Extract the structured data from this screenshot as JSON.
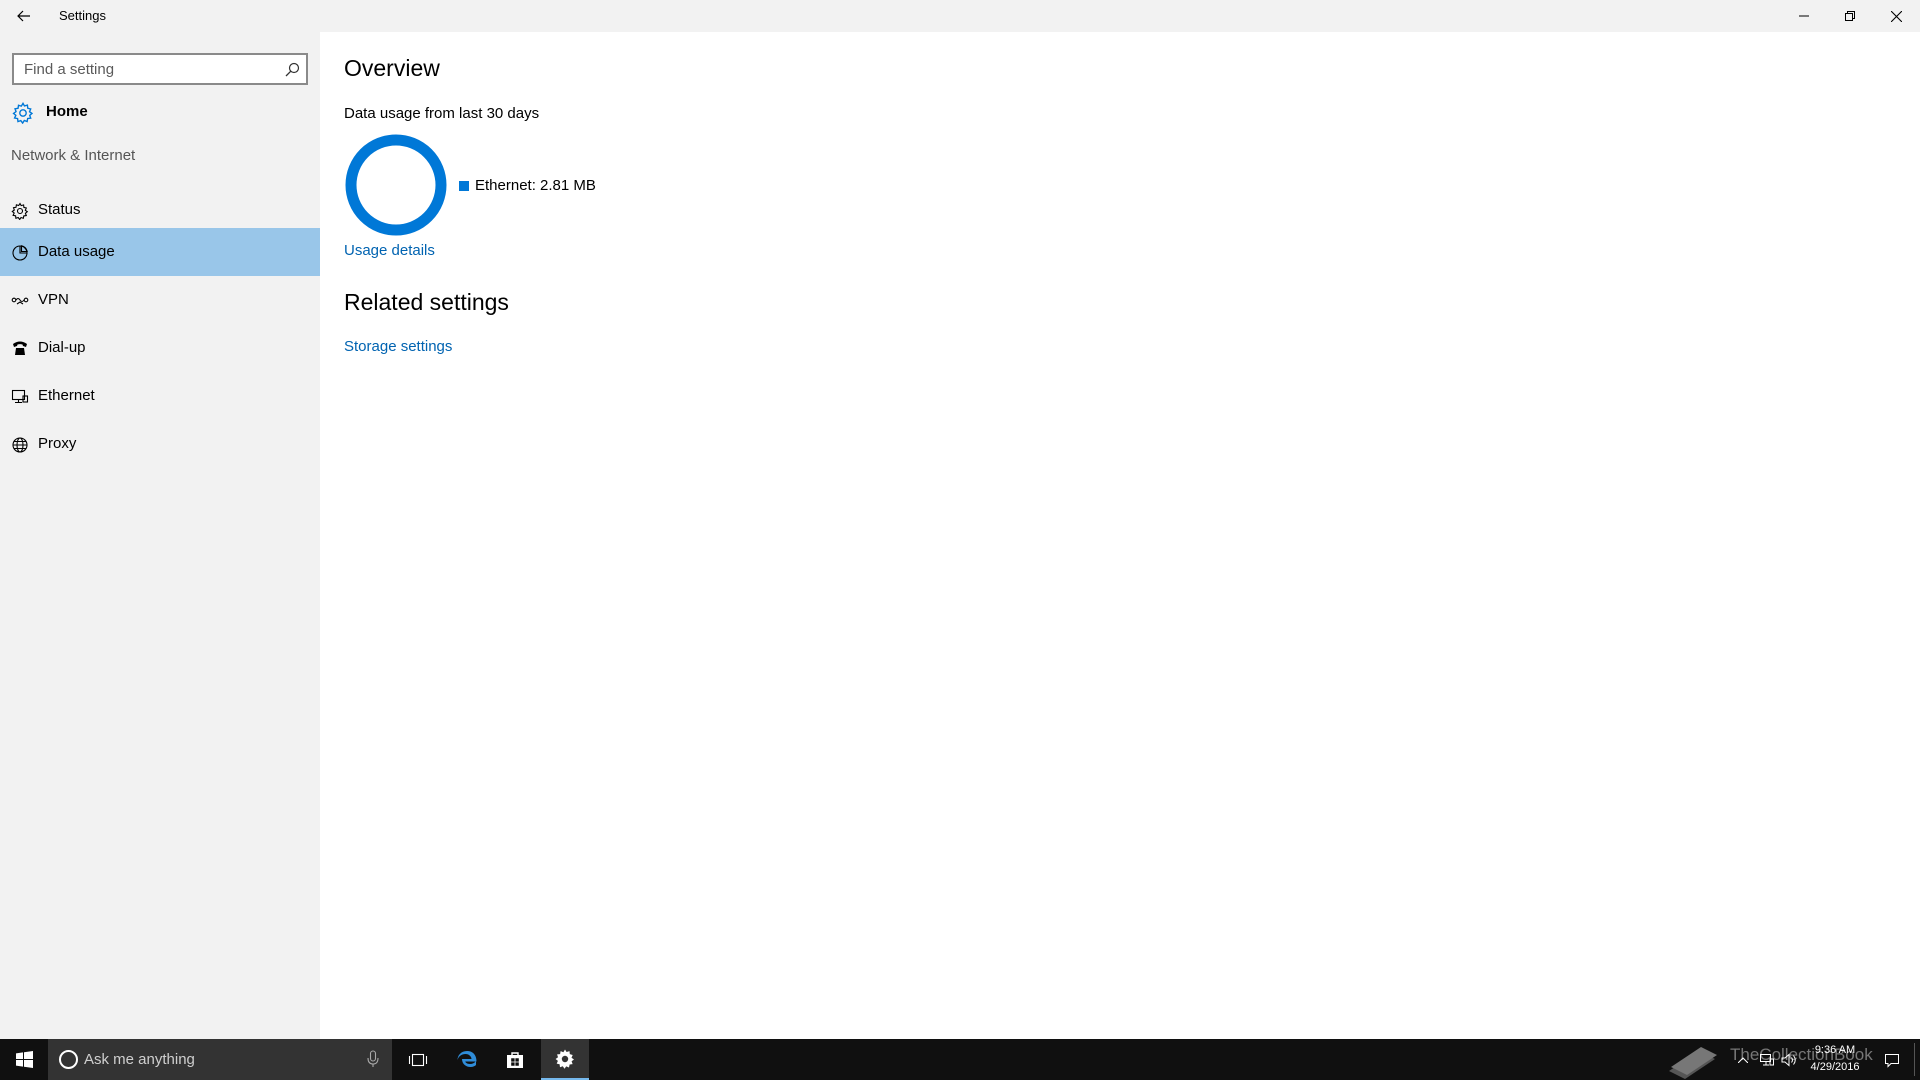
{
  "window": {
    "title": "Settings"
  },
  "sidebar": {
    "search_placeholder": "Find a setting",
    "home_label": "Home",
    "section_title": "Network & Internet",
    "items": [
      {
        "label": "Status",
        "icon": "gear-icon"
      },
      {
        "label": "Data usage",
        "icon": "pie-chart-icon",
        "selected": true
      },
      {
        "label": "VPN",
        "icon": "vpn-icon"
      },
      {
        "label": "Dial-up",
        "icon": "phone-icon"
      },
      {
        "label": "Ethernet",
        "icon": "ethernet-icon"
      },
      {
        "label": "Proxy",
        "icon": "globe-icon"
      }
    ]
  },
  "main": {
    "overview_title": "Overview",
    "subtitle": "Data usage from last 30 days",
    "legend_label": "Ethernet: 2.81 MB",
    "usage_link": "Usage details",
    "related_title": "Related settings",
    "storage_link": "Storage settings"
  },
  "taskbar": {
    "search_placeholder": "Ask me anything",
    "time": "9:36 AM",
    "date": "4/29/2016",
    "watermark": "TheCollectionBook"
  },
  "colors": {
    "accent": "#0078d7",
    "link": "#0063b1",
    "selected": "#99c6e9",
    "sidebar_bg": "#f2f2f2",
    "taskbar_bg": "#101010"
  }
}
